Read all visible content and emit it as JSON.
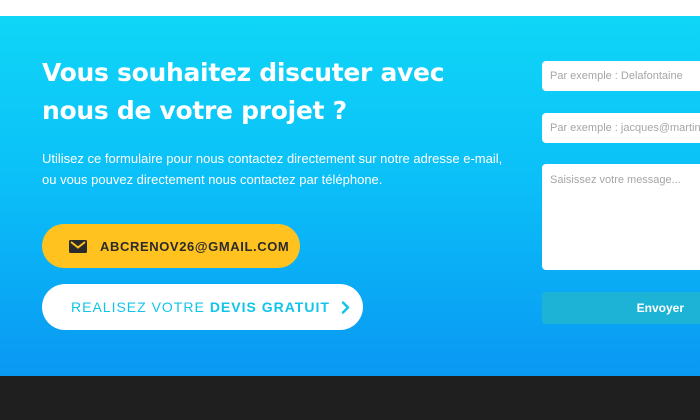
{
  "hero": {
    "headline": "Vous souhaitez discuter avec nous de votre projet ?",
    "intro": "Utilisez ce formulaire pour nous contactez directement sur notre adresse e-mail, ou vous pouvez directement nous contactez par téléphone.",
    "email_button_label": "ABCRENOV26@GMAIL.COM",
    "devis_button": {
      "prefix": "REALISEZ VOTRE",
      "emphasis": "DEVIS GRATUIT"
    }
  },
  "form": {
    "name_placeholder": "Par exemple : Delafontaine",
    "email_placeholder": "Par exemple : jacques@martin.fr",
    "message_placeholder": "Saisissez votre message...",
    "submit_label": "Envoyer"
  },
  "colors": {
    "accent_yellow": "#ffc21f",
    "cyan": "#12c4ea",
    "footer": "#1f1f1f"
  },
  "icons": {
    "email": "mail-icon",
    "devis": "chevron-right-icon"
  }
}
